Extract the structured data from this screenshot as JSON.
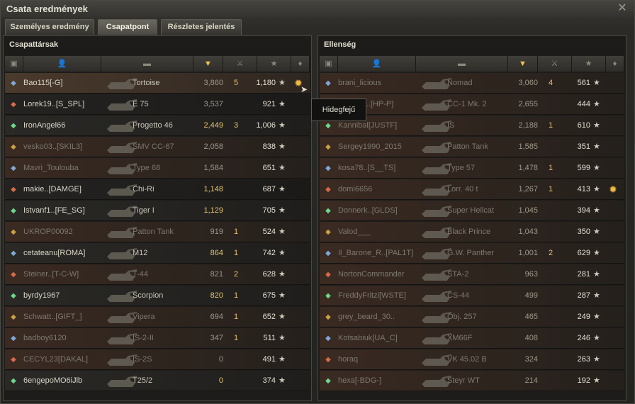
{
  "window": {
    "title": "Csata eredmények"
  },
  "tabs": [
    {
      "label": "Személyes eredmény"
    },
    {
      "label": "Csapatpont"
    },
    {
      "label": "Részletes jelentés"
    }
  ],
  "left": {
    "title": "Csapattársak",
    "rows": [
      {
        "name": "Bao115[-G]",
        "tank": "Tortoise",
        "dmg": "3,860",
        "kills": "5",
        "xp": "1,180",
        "style": "me",
        "medal": true
      },
      {
        "name": "Lorek19..[S_SPL]",
        "tank": "E 75",
        "dmg": "3,537",
        "kills": "",
        "xp": "921",
        "style": ""
      },
      {
        "name": "IronAngel66",
        "tank": "Progetto 46",
        "dmg": "2,449",
        "kills": "3",
        "xp": "1,006",
        "style": "",
        "hi": true
      },
      {
        "name": "vesko03..[SKIL3]",
        "tank": "SMV CC-67",
        "dmg": "2,058",
        "kills": "",
        "xp": "838",
        "style": "dead"
      },
      {
        "name": "Mavri_Toulouba",
        "tank": "Type 68",
        "dmg": "1,584",
        "kills": "",
        "xp": "651",
        "style": "dead"
      },
      {
        "name": "makie..[DAMGE]",
        "tank": "Chi-Ri",
        "dmg": "1,148",
        "kills": "",
        "xp": "687",
        "style": "",
        "hi": true
      },
      {
        "name": "Istvanf1..[FE_SG]",
        "tank": "Tiger I",
        "dmg": "1,129",
        "kills": "",
        "xp": "705",
        "style": "",
        "hi": true
      },
      {
        "name": "UKROP00092",
        "tank": "Patton Tank",
        "dmg": "919",
        "kills": "1",
        "xp": "524",
        "style": "dead"
      },
      {
        "name": "cetateanu[ROMA]",
        "tank": "M12",
        "dmg": "864",
        "kills": "1",
        "xp": "742",
        "style": "",
        "hi": true
      },
      {
        "name": "Steiner..[T-C-W]",
        "tank": "T-44",
        "dmg": "821",
        "kills": "2",
        "xp": "628",
        "style": "dead"
      },
      {
        "name": "byrdy1967",
        "tank": "Scorpion",
        "dmg": "820",
        "kills": "1",
        "xp": "675",
        "style": "",
        "hi": true
      },
      {
        "name": "Schwatt..[GIFT_]",
        "tank": "Vipera",
        "dmg": "694",
        "kills": "1",
        "xp": "652",
        "style": "dead"
      },
      {
        "name": "badboy6120",
        "tank": "IS-2-II",
        "dmg": "347",
        "kills": "1",
        "xp": "511",
        "style": "dead"
      },
      {
        "name": "CECYL23[DAKAL]",
        "tank": "IS-2S",
        "dmg": "0",
        "kills": "",
        "xp": "491",
        "style": "dead"
      },
      {
        "name": "6engepoMO6iJlb",
        "tank": "T25/2",
        "dmg": "0",
        "kills": "",
        "xp": "374",
        "style": "",
        "hi": true
      }
    ]
  },
  "right": {
    "title": "Ellenség",
    "rows": [
      {
        "name": "brani_licious",
        "tank": "Nomad",
        "dmg": "3,060",
        "kills": "4",
        "xp": "561",
        "style": "dead"
      },
      {
        "name": "...ego_3..[HP-P]",
        "tank": "CC-1 Mk. 2",
        "dmg": "2,655",
        "kills": "",
        "xp": "444",
        "style": "dead"
      },
      {
        "name": "Kannibal[JUSTF]",
        "tank": "IS",
        "dmg": "2,188",
        "kills": "1",
        "xp": "610",
        "style": "dead"
      },
      {
        "name": "Sergey1990_2015",
        "tank": "Patton Tank",
        "dmg": "1,585",
        "kills": "",
        "xp": "351",
        "style": "dead"
      },
      {
        "name": "kosa78..[S__TS]",
        "tank": "Type 57",
        "dmg": "1,478",
        "kills": "1",
        "xp": "599",
        "style": "dead"
      },
      {
        "name": "domi6656",
        "tank": "Lorr. 40 t",
        "dmg": "1,267",
        "kills": "1",
        "xp": "413",
        "style": "dead",
        "medal": true
      },
      {
        "name": "Donnerk..[GLDS]",
        "tank": "Super Hellcat",
        "dmg": "1,045",
        "kills": "",
        "xp": "394",
        "style": "dead"
      },
      {
        "name": "Valod___",
        "tank": "Black Prince",
        "dmg": "1,043",
        "kills": "",
        "xp": "350",
        "style": "dead"
      },
      {
        "name": "Il_Barone_R..[PAL1T]",
        "tank": "G.W. Panther",
        "dmg": "1,001",
        "kills": "2",
        "xp": "629",
        "style": "dead"
      },
      {
        "name": "NortonCommander",
        "tank": "STA-2",
        "dmg": "963",
        "kills": "",
        "xp": "281",
        "style": "dead"
      },
      {
        "name": "FreddyFritzi[WSTE]",
        "tank": "CS-44",
        "dmg": "499",
        "kills": "",
        "xp": "287",
        "style": "dead"
      },
      {
        "name": "grey_beard_30..",
        "tank": "Obj. 257",
        "dmg": "465",
        "kills": "",
        "xp": "249",
        "style": "dead"
      },
      {
        "name": "Kotsabiuk[UA_C]",
        "tank": "XM66F",
        "dmg": "408",
        "kills": "",
        "xp": "246",
        "style": "dead"
      },
      {
        "name": "horaq",
        "tank": "VK 45.02 B",
        "dmg": "324",
        "kills": "",
        "xp": "263",
        "style": "dead"
      },
      {
        "name": "hexa[-BDG-]",
        "tank": "Steyr WT",
        "dmg": "214",
        "kills": "",
        "xp": "192",
        "style": "dead"
      }
    ]
  },
  "tooltip": {
    "text": "Hidegfejű"
  },
  "icons": {
    "close": "close-icon",
    "star": "★",
    "medal": "medal-icon"
  }
}
